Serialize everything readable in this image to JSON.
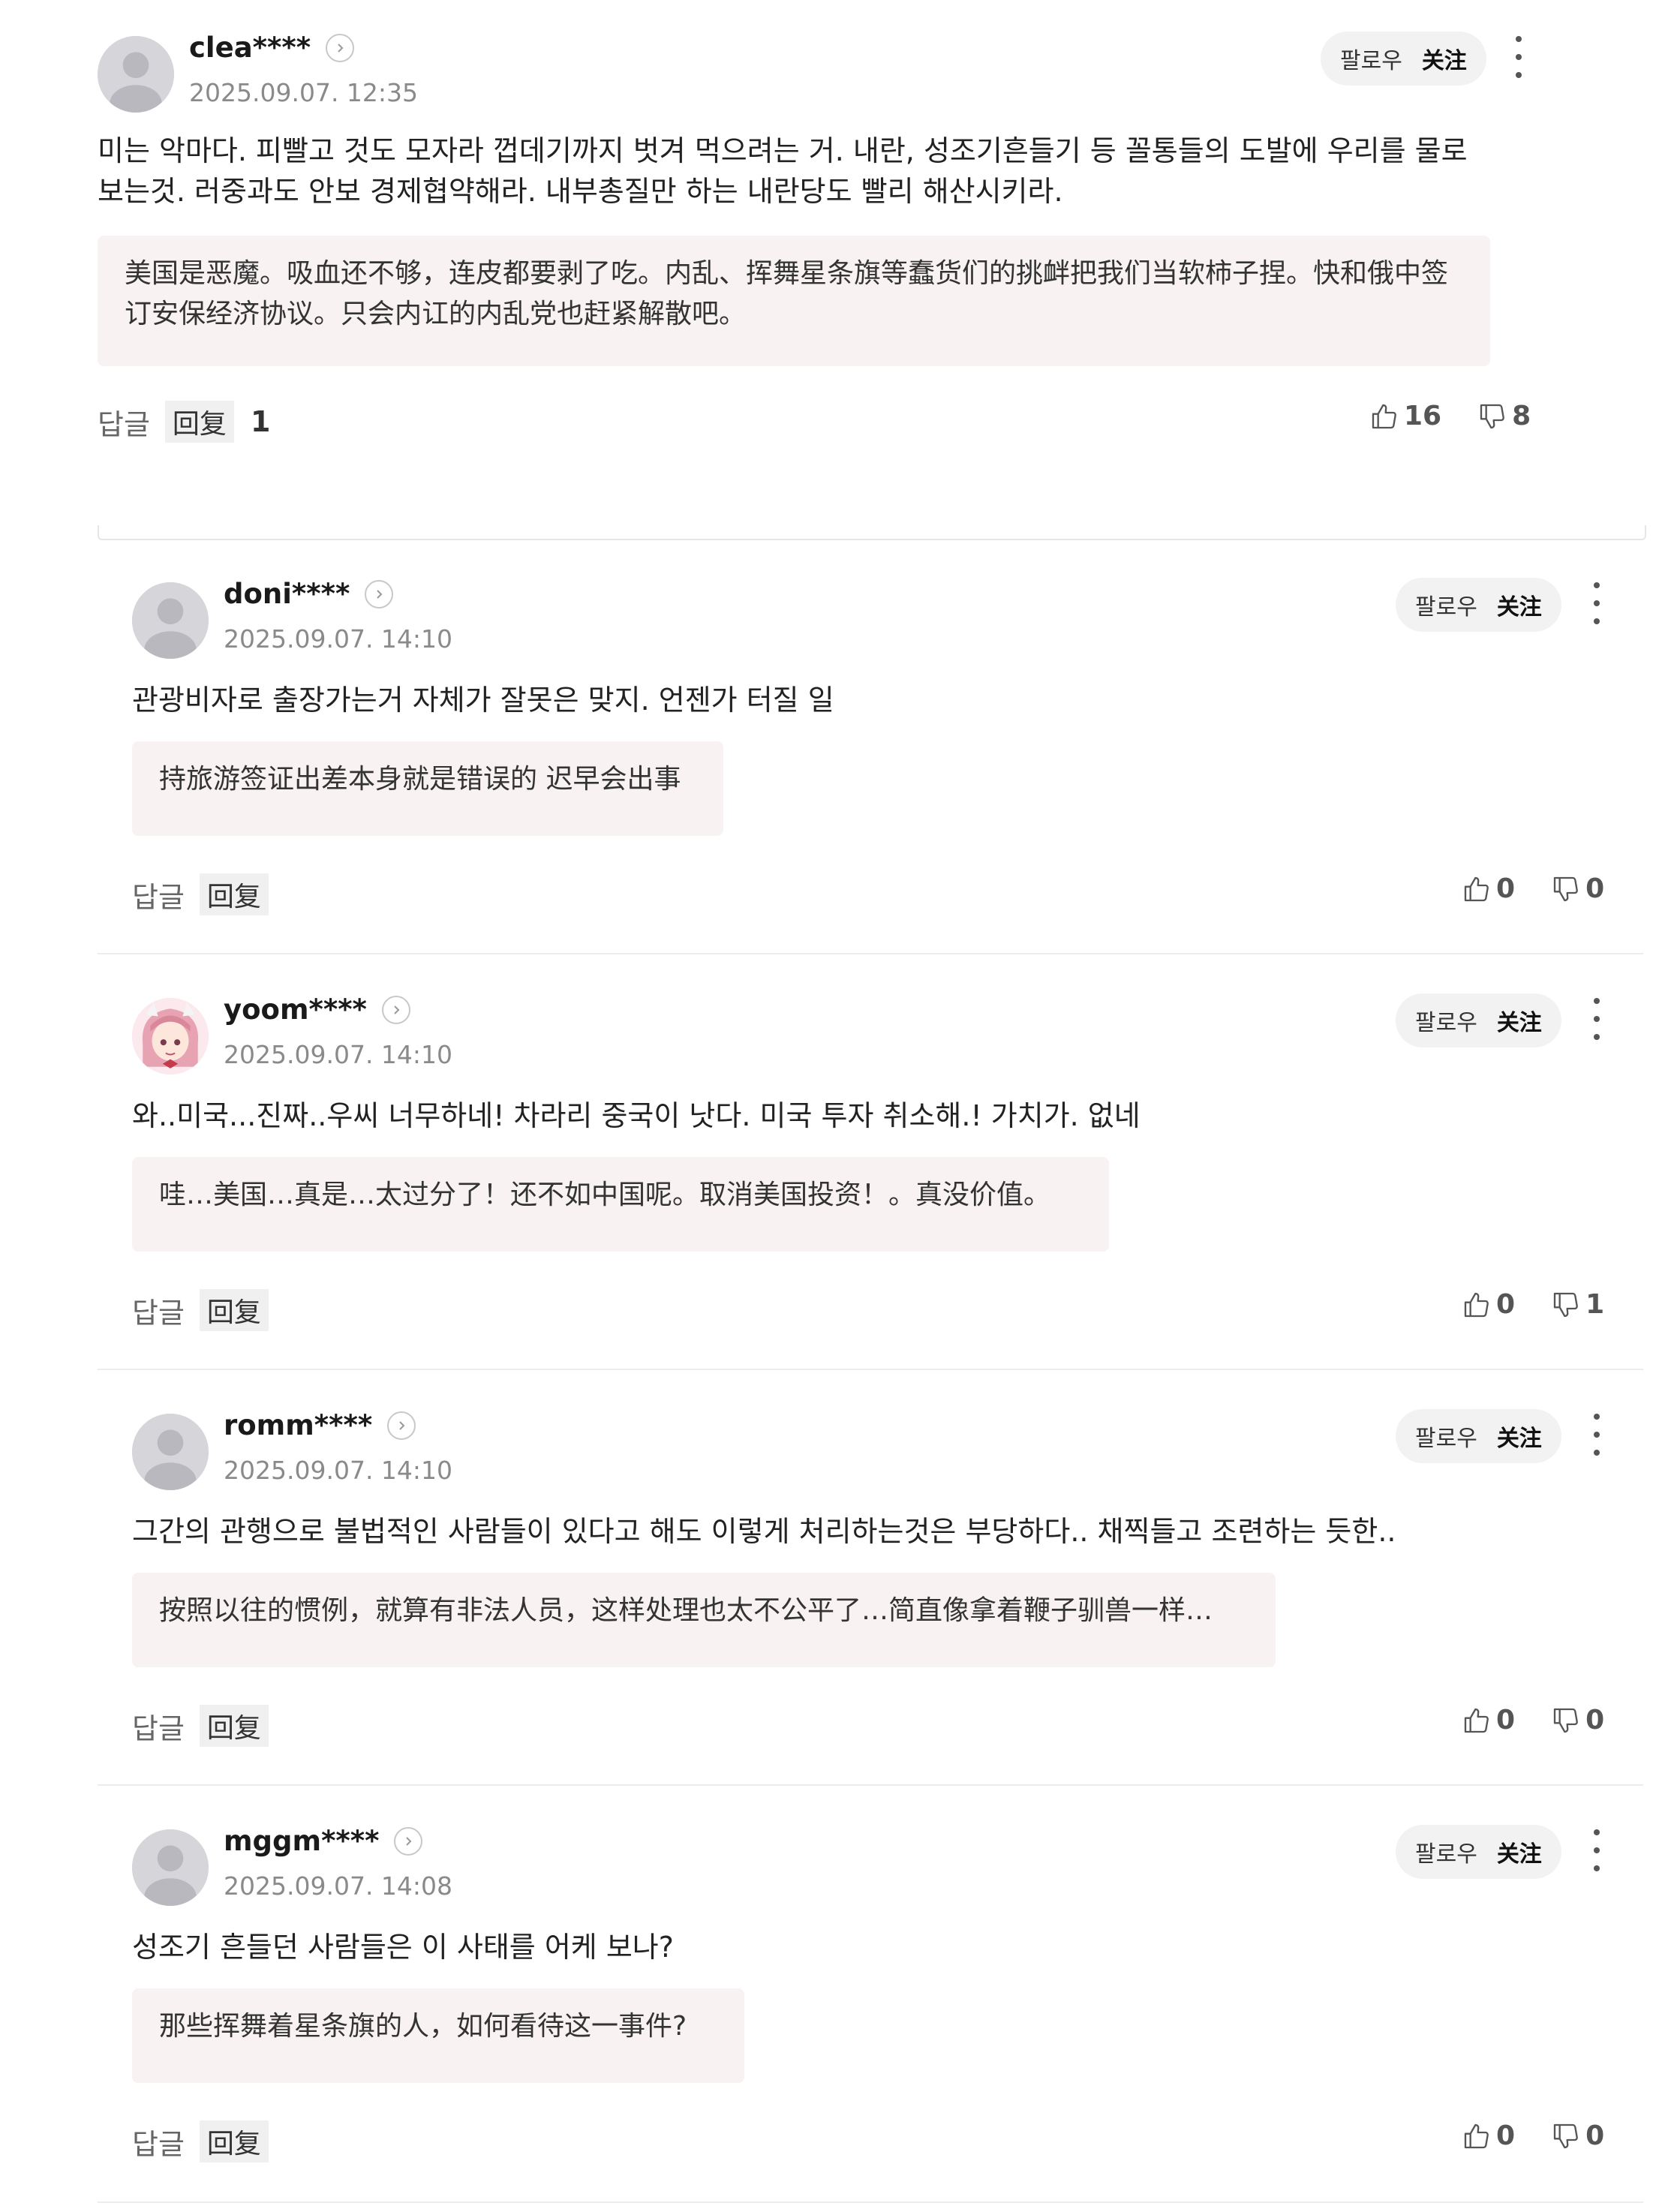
{
  "comments": [
    {
      "username": "clea****",
      "date": "2025.09.07. 12:35",
      "follow_ko": "팔로우",
      "follow_zh": "关注",
      "text_lines": [
        "미는 악마다. 피빨고 것도 모자라 껍데기까지 벗겨 먹으려는 거. 내란, 성조기흔들기 등 꼴통들의 도발에 우리를 물로",
        "보는것. 러중과도 안보 경제협약해라. 내부총질만 하는 내란당도 빨리 해산시키라."
      ],
      "translation_lines": [
        "美国是恶魔。吸血还不够，连皮都要剥了吃。内乱、挥舞星条旗等蠢货们的挑衅把我们当软柿子捏。快和俄中签",
        "订安保经济协议。只会内讧的内乱党也赶紧解散吧。"
      ],
      "reply_ko": "답글",
      "reply_zh": "回复",
      "reply_count": "1",
      "likes": "16",
      "dislikes": "8"
    },
    {
      "username": "doni****",
      "date": "2025.09.07. 14:10",
      "follow_ko": "팔로우",
      "follow_zh": "关注",
      "text_lines": [
        "관광비자로 출장가는거 자체가 잘못은 맞지. 언젠가 터질 일"
      ],
      "translation_lines": [
        "持旅游签证出差本身就是错误的 迟早会出事"
      ],
      "reply_ko": "답글",
      "reply_zh": "回复",
      "likes": "0",
      "dislikes": "0"
    },
    {
      "username": "yoom****",
      "date": "2025.09.07. 14:10",
      "follow_ko": "팔로우",
      "follow_zh": "关注",
      "text_lines": [
        "와..미국...진짜..우씨 너무하네! 차라리 중국이 낫다. 미국 투자 취소해.! 가치가. 없네"
      ],
      "translation_lines": [
        "哇…美国…真是…太过分了！还不如中国呢。取消美国投资！。真没价值。"
      ],
      "reply_ko": "답글",
      "reply_zh": "回复",
      "likes": "0",
      "dislikes": "1"
    },
    {
      "username": "romm****",
      "date": "2025.09.07. 14:10",
      "follow_ko": "팔로우",
      "follow_zh": "关注",
      "text_lines": [
        "그간의 관행으로 불법적인 사람들이 있다고 해도 이렇게 처리하는것은 부당하다.. 채찍들고 조련하는 듯한.."
      ],
      "translation_lines": [
        "按照以往的惯例，就算有非法人员，这样处理也太不公平了…简直像拿着鞭子驯兽一样…"
      ],
      "reply_ko": "답글",
      "reply_zh": "回复",
      "likes": "0",
      "dislikes": "0"
    },
    {
      "username": "mggm****",
      "date": "2025.09.07. 14:08",
      "follow_ko": "팔로우",
      "follow_zh": "关注",
      "text_lines": [
        "성조기 흔들던 사람들은 이 사태를 어케 보나?"
      ],
      "translation_lines": [
        "那些挥舞着星条旗的人，如何看待这一事件?"
      ],
      "reply_ko": "답글",
      "reply_zh": "回复",
      "likes": "0",
      "dislikes": "0"
    }
  ],
  "icons": {
    "avatar_default": "person-silhouette",
    "avatar_anime": "anime-character",
    "chevron": "chevron-right-icon",
    "like": "thumbs-up-icon",
    "dislike": "thumbs-down-icon",
    "more": "kebab-menu-icon"
  },
  "colors": {
    "translation_bg": "#f8f2f2",
    "follow_bg": "#f2f2f2",
    "date_text": "#8a8a8a"
  }
}
